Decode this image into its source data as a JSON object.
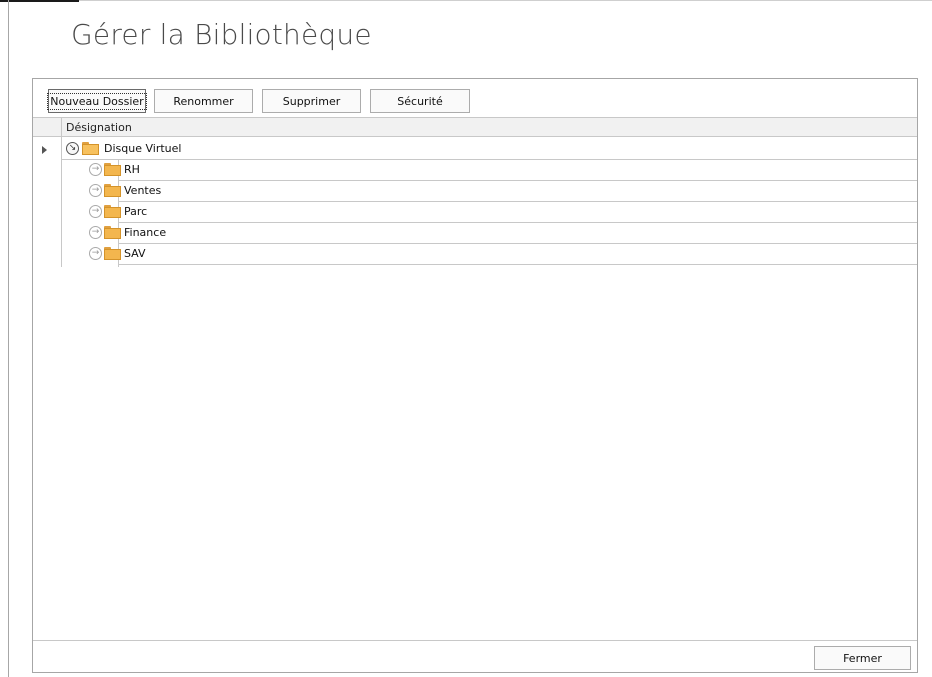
{
  "page": {
    "title": "Gérer la Bibliothèque"
  },
  "toolbar": {
    "new_folder_label": "Nouveau Dossier",
    "rename_label": "Renommer",
    "delete_label": "Supprimer",
    "security_label": "Sécurité"
  },
  "grid": {
    "column_header": "Désignation",
    "root": {
      "label": "Disque Virtuel",
      "icon": "folder-open-icon",
      "expanded": true
    },
    "children": [
      {
        "label": "RH",
        "icon": "folder-icon"
      },
      {
        "label": "Ventes",
        "icon": "folder-icon"
      },
      {
        "label": "Parc",
        "icon": "folder-icon"
      },
      {
        "label": "Finance",
        "icon": "folder-icon"
      },
      {
        "label": "SAV",
        "icon": "folder-icon"
      }
    ]
  },
  "footer": {
    "close_label": "Fermer"
  },
  "colors": {
    "folder": "#f3b64e",
    "border": "#c8c8c8",
    "title": "#4a4a4a"
  }
}
